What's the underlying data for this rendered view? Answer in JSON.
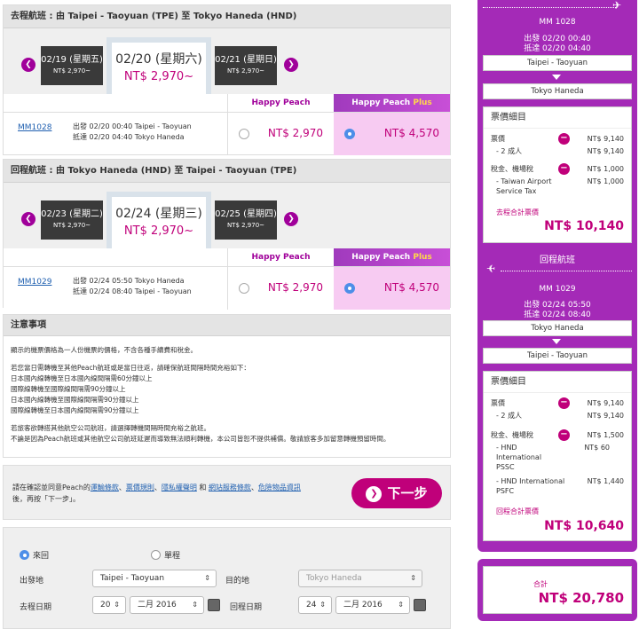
{
  "outbound": {
    "header": "去程航班 : 由 Taipei - Taoyuan (TPE) 至 Tokyo Haneda (HND)",
    "prev_date": "02/19 (星期五)",
    "prev_price": "NT$ 2,970~",
    "sel_date": "02/20 (星期六)",
    "sel_price": "NT$ 2,970~",
    "next_date": "02/21 (星期日)",
    "next_price": "NT$ 2,970~",
    "basic_label": "Happy Peach",
    "plus_label": "Happy Peach",
    "plus_suffix": "Plus",
    "flight_no": "MM1028",
    "dep_line": "出發 02/20 00:40 Taipei - Taoyuan",
    "arr_line": "抵達 02/20 04:40 Tokyo Haneda",
    "basic_price": "NT$ 2,970",
    "plus_price": "NT$ 4,570"
  },
  "inbound": {
    "header": "回程航班 : 由 Tokyo Haneda (HND) 至 Taipei - Taoyuan (TPE)",
    "prev_date": "02/23 (星期二)",
    "prev_price": "NT$ 2,970~",
    "sel_date": "02/24 (星期三)",
    "sel_price": "NT$ 2,970~",
    "next_date": "02/25 (星期四)",
    "next_price": "NT$ 2,970~",
    "basic_label": "Happy Peach",
    "plus_label": "Happy Peach",
    "plus_suffix": "Plus",
    "flight_no": "MM1029",
    "dep_line": "出發 02/24 05:50 Tokyo Haneda",
    "arr_line": "抵達 02/24 08:40 Taipei - Taoyuan",
    "basic_price": "NT$ 2,970",
    "plus_price": "NT$ 4,570"
  },
  "notes": {
    "header": "注意事項",
    "p1": "顯示的機票價格為一人份機票的價格，不含各種手續費和稅金。",
    "p2": "若您當日需轉機至其他Peach航班或是當日往返，請確保航班間隔時間充裕如下：",
    "p3": "日本國內線轉機至日本國內線間隔需60分鐘以上",
    "p4": "國際線轉機至國際線間隔需90分鐘以上",
    "p5": "日本國內線轉機至國際線間隔需90分鐘以上",
    "p6": "國際線轉機至日本國內線間隔需90分鐘以上",
    "p7": "若旅客欲轉搭其他航空公司航班，請選擇轉機間隔時間充裕之航班。",
    "p8": "不論是因為Peach航班或其他航空公司航班延遲而導致無法順利轉機，本公司皆恕不提供補償。敬請旅客多加留意轉機預留時間。"
  },
  "confirm": {
    "pre": "請在確認並同意Peach的",
    "l1": "運輸條款",
    "c1": "、",
    "l2": "票價規則",
    "c2": "、",
    "l3": "隱私權聲明",
    "c3": " 和 ",
    "l4": "網站服務條款",
    "c4": "、",
    "l5": "危險物品資訊",
    "post": "後，再按「下一步」。",
    "next_label": "下一步"
  },
  "search": {
    "roundtrip": "來回",
    "oneway": "單程",
    "from_label": "出發地",
    "from_value": "Taipei - Taoyuan",
    "to_label": "目的地",
    "to_value": "Tokyo Haneda",
    "dep_label": "去程日期",
    "dep_day": "20",
    "dep_month": "二月 2016",
    "ret_label": "回程日期",
    "ret_day": "24",
    "ret_month": "二月 2016"
  },
  "summary": {
    "out_flight": "MM 1028",
    "out_dep": "出發 02/20 00:40",
    "out_arr": "抵達 02/20 04:40",
    "out_from": "Taipei - Taoyuan",
    "out_to": "Tokyo Haneda",
    "fare_title": "票價細目",
    "out_fare_label": "票價",
    "out_fare_total": "NT$ 9,140",
    "out_pax": "- 2  成人",
    "out_pax_val": "NT$ 9,140",
    "out_tax_label": "稅金、機場稅",
    "out_tax_total": "NT$ 1,000",
    "out_tax_item": "- Taiwan Airport Service Tax",
    "out_tax_item_val": "NT$ 1,000",
    "out_total_label": "去程合計票價",
    "out_total": "NT$ 10,140",
    "ret_title": "回程航班",
    "ret_flight": "MM 1029",
    "ret_dep": "出發 02/24 05:50",
    "ret_arr": "抵達 02/24 08:40",
    "ret_from": "Tokyo Haneda",
    "ret_to": "Taipei - Taoyuan",
    "ret_fare_label": "票價",
    "ret_fare_total": "NT$ 9,140",
    "ret_pax": "- 2  成人",
    "ret_pax_val": "NT$ 9,140",
    "ret_tax_label": "稅金、機場稅",
    "ret_tax_total": "NT$ 1,500",
    "ret_tax_item1": "- HND International PSSC",
    "ret_tax_item1_val": "NT$ 60",
    "ret_tax_item2": "- HND International PSFC",
    "ret_tax_item2_val": "NT$ 1,440",
    "ret_total_label": "回程合計票價",
    "ret_total": "NT$ 10,640",
    "grand_label": "合計",
    "grand_total": "NT$ 20,780"
  },
  "colors": {
    "accent": "#c0007a",
    "purple": "#a42ab7",
    "link": "#2060b0"
  }
}
